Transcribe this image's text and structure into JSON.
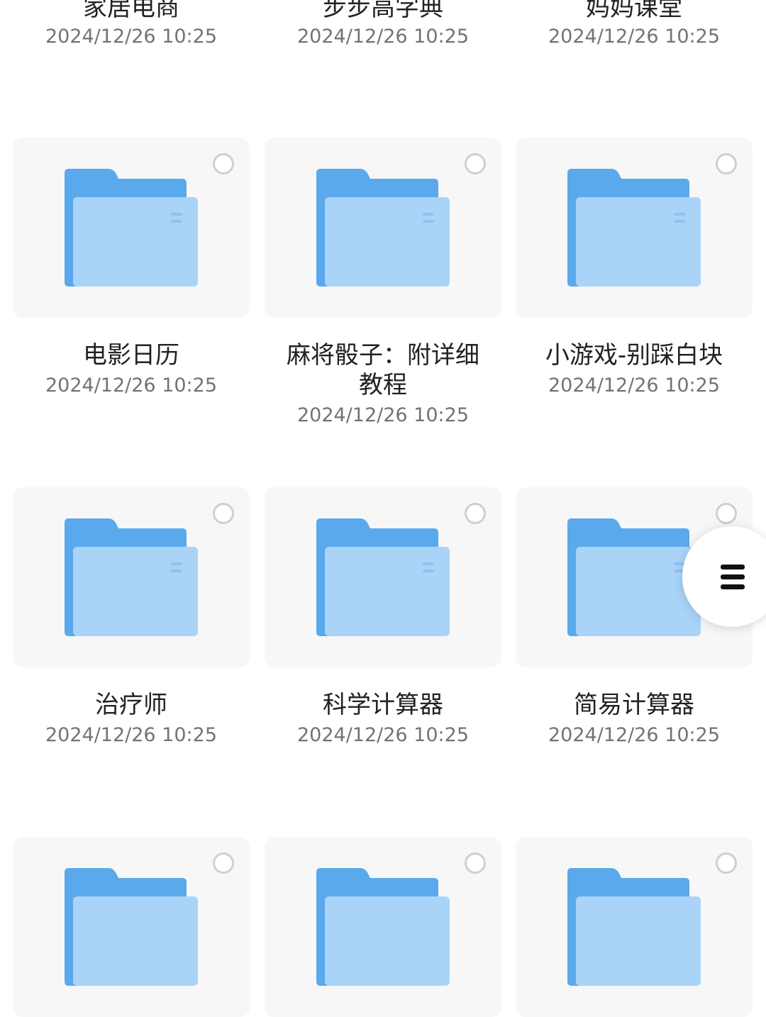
{
  "folders": [
    {
      "name": "家居电商",
      "date": "2024/12/26 10:25"
    },
    {
      "name": "步步高字典",
      "date": "2024/12/26 10:25"
    },
    {
      "name": "妈妈课堂",
      "date": "2024/12/26 10:25"
    },
    {
      "name": "电影日历",
      "date": "2024/12/26 10:25"
    },
    {
      "name": "麻将骰子：附详细\n教程",
      "date": "2024/12/26 10:25"
    },
    {
      "name": "小游戏-别踩白块",
      "date": "2024/12/26 10:25"
    },
    {
      "name": "治疗师",
      "date": "2024/12/26 10:25"
    },
    {
      "name": "科学计算器",
      "date": "2024/12/26 10:25"
    },
    {
      "name": "简易计算器",
      "date": "2024/12/26 10:25"
    },
    {
      "name": "",
      "date": ""
    },
    {
      "name": "",
      "date": ""
    },
    {
      "name": "",
      "date": ""
    }
  ],
  "icons": {
    "folder": "folder-icon",
    "checkbox": "selection-circle-icon",
    "menu": "menu-icon"
  },
  "colors": {
    "folder_back": "#5aa9ec",
    "folder_front": "#a9d4f7",
    "checkbox_border": "#cfcfcf",
    "card_bg": "#f7f7f7"
  }
}
